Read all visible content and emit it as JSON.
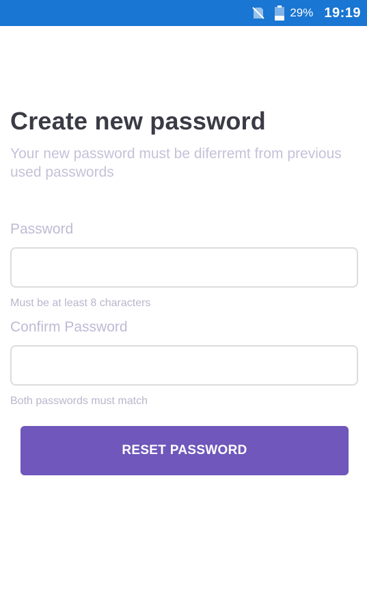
{
  "status_bar": {
    "battery_percent": "29%",
    "time": "19:19",
    "background_color": "#1976d2",
    "icons": [
      "no-sim-icon",
      "battery-icon"
    ]
  },
  "page": {
    "title": "Create new password",
    "subtitle": "Your new password must be diferremt from previous used passwords"
  },
  "password": {
    "label": "Password",
    "value": "",
    "hint": "Must be at least 8 characters"
  },
  "confirm_password": {
    "label": "Confirm Password",
    "value": "",
    "hint": "Both passwords must match"
  },
  "reset_button": {
    "label": "RESET PASSWORD",
    "color": "#6f57bb"
  }
}
